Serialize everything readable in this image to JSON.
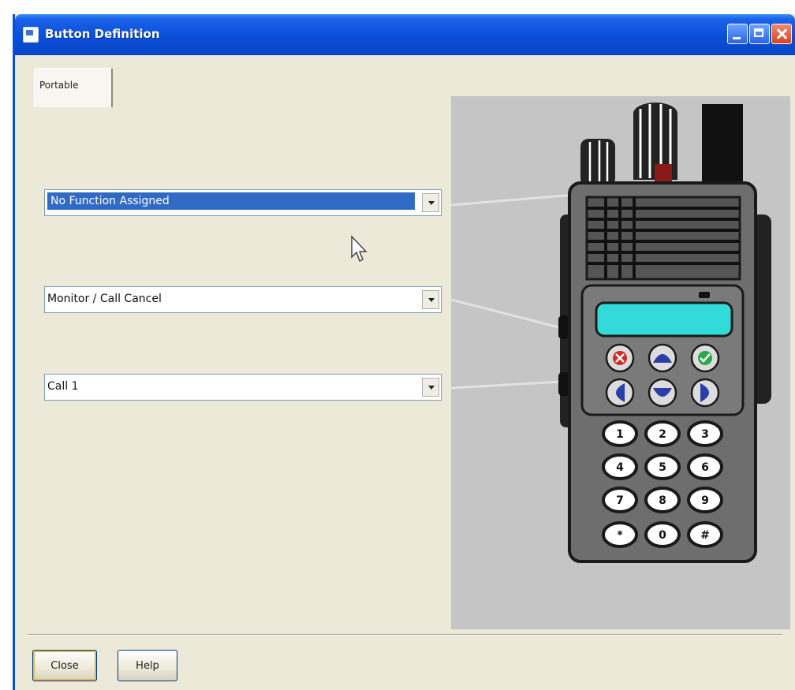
{
  "window": {
    "title": "Button Definition"
  },
  "tabs": [
    {
      "label": "Portable"
    }
  ],
  "button_assignments": [
    {
      "value": "No Function Assigned",
      "selected": true
    },
    {
      "value": "Monitor / Call Cancel",
      "selected": false
    },
    {
      "value": "Call 1",
      "selected": false
    }
  ],
  "keypad": {
    "keys": [
      [
        "1",
        "2",
        "3"
      ],
      [
        "4",
        "5",
        "6"
      ],
      [
        "7",
        "8",
        "9"
      ],
      [
        "*",
        "0",
        "#"
      ]
    ]
  },
  "footer": {
    "close_label": "Close",
    "help_label": "Help"
  },
  "colors": {
    "title_bar": "#0a4fd8",
    "window_background": "#ece9d8",
    "selection": "#316ac5",
    "radio_body": "#6e6e6e",
    "lcd_display": "#33dada",
    "panel_background": "#c5c5c5"
  }
}
